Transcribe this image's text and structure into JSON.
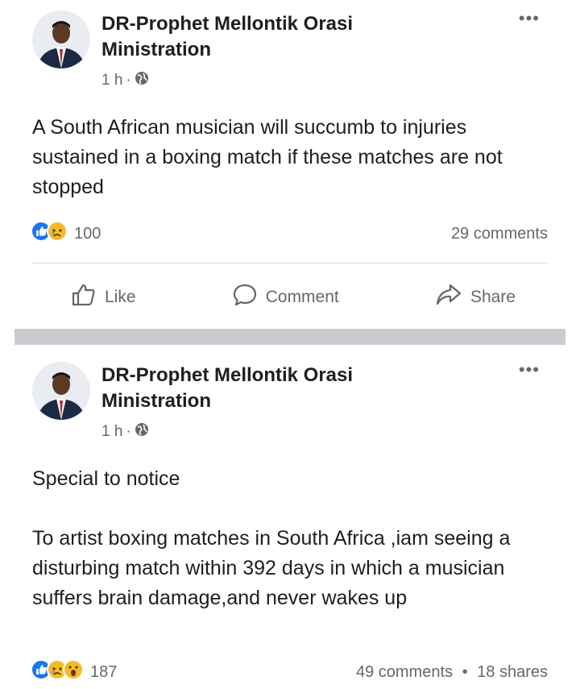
{
  "posts": [
    {
      "author": "DR-Prophet Mellontik Orasi Ministration",
      "time": "1 h",
      "separator": "·",
      "audience_icon": "globe-icon",
      "more_icon": "more-options-icon",
      "more_glyph": "•••",
      "paragraphs": [
        "A South African musician will succumb to injuries sustained in a boxing match if these matches are not stopped"
      ],
      "reactions": {
        "icons": [
          "like",
          "sad"
        ],
        "count": "100"
      },
      "comments": "29 comments",
      "actions": {
        "like": "Like",
        "comment": "Comment",
        "share": "Share"
      }
    },
    {
      "author": "DR-Prophet Mellontik Orasi Ministration",
      "time": "1 h",
      "separator": "·",
      "audience_icon": "globe-icon",
      "more_icon": "more-options-icon",
      "more_glyph": "•••",
      "paragraphs": [
        "Special to notice",
        "To artist boxing matches in South Africa ,iam seeing a disturbing match within 392 days in which a musician suffers brain damage,and never wakes up"
      ],
      "reactions": {
        "icons": [
          "like",
          "sad",
          "wow"
        ],
        "count": "187"
      },
      "comments": "49 comments",
      "dot": "•",
      "shares": "18 shares"
    }
  ],
  "colors": {
    "like_blue": "#1877f2",
    "muted": "#65676b",
    "text": "#1c1e21",
    "divider": "#c9ccd1"
  }
}
